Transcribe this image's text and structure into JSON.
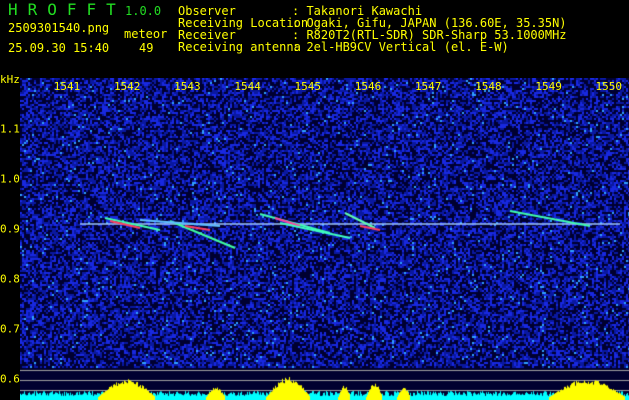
{
  "header": {
    "app_title": "HROFFT",
    "version": "1.0.0",
    "filename": "2509301540.png",
    "datetime": "25.09.30 15:40",
    "meteor_label": "meteor",
    "meteor_count": "49",
    "info": [
      {
        "label": "Observer",
        "value": ": Takanori Kawachi"
      },
      {
        "label": "Receiving Location",
        "value": ": Ogaki, Gifu, JAPAN (136.60E, 35.35N)"
      },
      {
        "label": "Receiver",
        "value": ": R820T2(RTL-SDR) SDR-Sharp 53.1000MHz"
      },
      {
        "label": "Receiving antenna",
        "value": ": 2el-HB9CV Vertical (el. E-W)"
      }
    ]
  },
  "spectrogram": {
    "y_unit": "kHz",
    "x_ticks": [
      "1541",
      "1542",
      "1543",
      "1544",
      "1545",
      "1546",
      "1547",
      "1548",
      "1549",
      "1550"
    ],
    "y_ticks": [
      "1.1",
      "1.0",
      "0.9",
      "0.8",
      "0.7",
      "0.6"
    ],
    "colors": {
      "background": "#000080",
      "noise": "#1a2aff",
      "histogram": "#ffff00",
      "baseline": "#00ffff",
      "text": "#ffff00",
      "title": "#22dd22"
    }
  }
}
